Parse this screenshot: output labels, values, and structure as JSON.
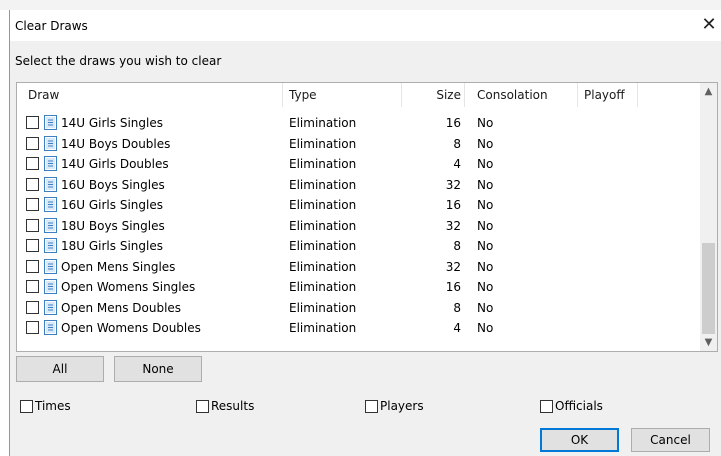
{
  "window": {
    "title": "Clear Draws",
    "close_glyph": "✕",
    "subtitle": "Select the draws you wish to clear"
  },
  "table": {
    "columns": [
      "Draw",
      "Type",
      "Size",
      "Consolation",
      "Playoff"
    ],
    "rows": [
      {
        "draw": "14U Girls Singles",
        "type": "Elimination",
        "size": "16",
        "consolation": "No",
        "playoff": ""
      },
      {
        "draw": "14U Boys Doubles",
        "type": "Elimination",
        "size": "8",
        "consolation": "No",
        "playoff": ""
      },
      {
        "draw": "14U Girls Doubles",
        "type": "Elimination",
        "size": "4",
        "consolation": "No",
        "playoff": ""
      },
      {
        "draw": "16U Boys Singles",
        "type": "Elimination",
        "size": "32",
        "consolation": "No",
        "playoff": ""
      },
      {
        "draw": "16U Girls Singles",
        "type": "Elimination",
        "size": "16",
        "consolation": "No",
        "playoff": ""
      },
      {
        "draw": "18U Boys Singles",
        "type": "Elimination",
        "size": "32",
        "consolation": "No",
        "playoff": ""
      },
      {
        "draw": "18U Girls Singles",
        "type": "Elimination",
        "size": "8",
        "consolation": "No",
        "playoff": ""
      },
      {
        "draw": "Open Mens Singles",
        "type": "Elimination",
        "size": "32",
        "consolation": "No",
        "playoff": ""
      },
      {
        "draw": "Open Womens Singles",
        "type": "Elimination",
        "size": "16",
        "consolation": "No",
        "playoff": ""
      },
      {
        "draw": "Open Mens Doubles",
        "type": "Elimination",
        "size": "8",
        "consolation": "No",
        "playoff": ""
      },
      {
        "draw": "Open Womens Doubles",
        "type": "Elimination",
        "size": "4",
        "consolation": "No",
        "playoff": ""
      }
    ]
  },
  "selection_buttons": {
    "all": "All",
    "none": "None"
  },
  "options": {
    "times": "Times",
    "results": "Results",
    "players": "Players",
    "officials": "Officials"
  },
  "dialog_buttons": {
    "ok": "OK",
    "cancel": "Cancel"
  },
  "icons": {
    "draw_row": "document-icon",
    "scroll_up": "chevron-up-icon",
    "scroll_down": "chevron-down-icon",
    "close": "close-icon"
  },
  "colors": {
    "accent": "#0078d7",
    "window_bg": "#f0f0f0",
    "icon_blue": "#3b7fc4"
  }
}
